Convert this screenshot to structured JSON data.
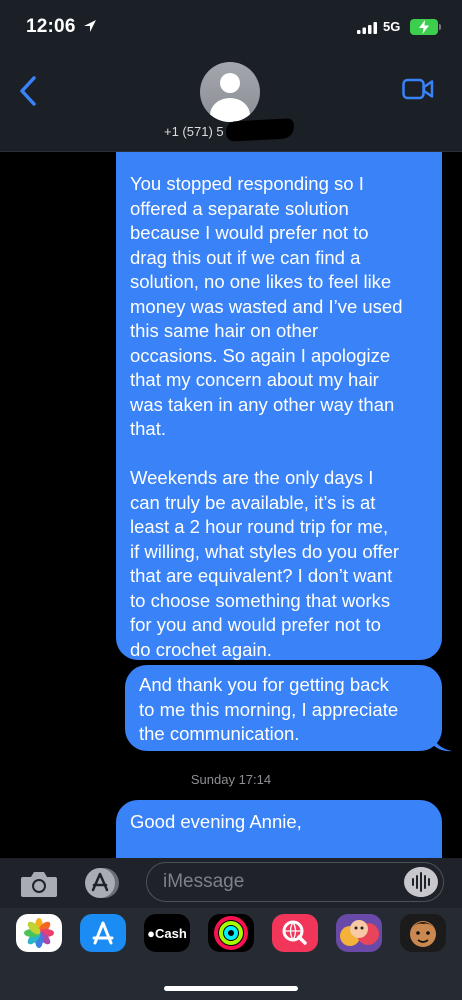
{
  "status_bar": {
    "time": "12:06",
    "network": "5G",
    "battery_color": "#3ccf4e"
  },
  "header": {
    "contact_number": "+1 (571) 5",
    "back_icon": "chevron-left-icon",
    "video_icon": "video-camera-icon",
    "accent_color": "#3a82f7"
  },
  "messages": [
    {
      "direction": "sent",
      "text": "You stopped responding so I\noffered a separate solution\nbecause I would prefer not to\ndrag this out if we can find a\nsolution, no one likes to feel like\nmoney was wasted and I’ve used\nthis same hair on other\noccasions. So again I apologize\nthat my concern about my hair\nwas taken in any other way than\nthat.\n\nWeekends are the only days I\ncan truly be available, it’s is at\nleast a 2 hour round trip for me,\nif willing, what styles do you offer\nthat are equivalent? I don’t want\nto choose something that works\nfor you and would prefer not to\ndo crochet again."
    },
    {
      "direction": "sent",
      "text": "And thank you for getting back\nto me this morning, I appreciate\nthe communication."
    },
    {
      "direction": "sent",
      "text": "Good evening Annie,"
    }
  ],
  "timestamp": "Sunday 17:14",
  "input": {
    "placeholder": "iMessage"
  },
  "app_drawer": {
    "apps": [
      {
        "name": "Photos",
        "icon": "photos-icon"
      },
      {
        "name": "App Store",
        "icon": "app-store-icon"
      },
      {
        "name": "Cash",
        "label": "Cash",
        "icon": "apple-cash-icon"
      },
      {
        "name": "Activity",
        "icon": "activity-rings-icon"
      },
      {
        "name": "Search",
        "icon": "web-search-icon"
      },
      {
        "name": "Memoji Stickers",
        "icon": "memoji-icon"
      },
      {
        "name": "Memoji",
        "icon": "memoji-icon"
      }
    ]
  }
}
